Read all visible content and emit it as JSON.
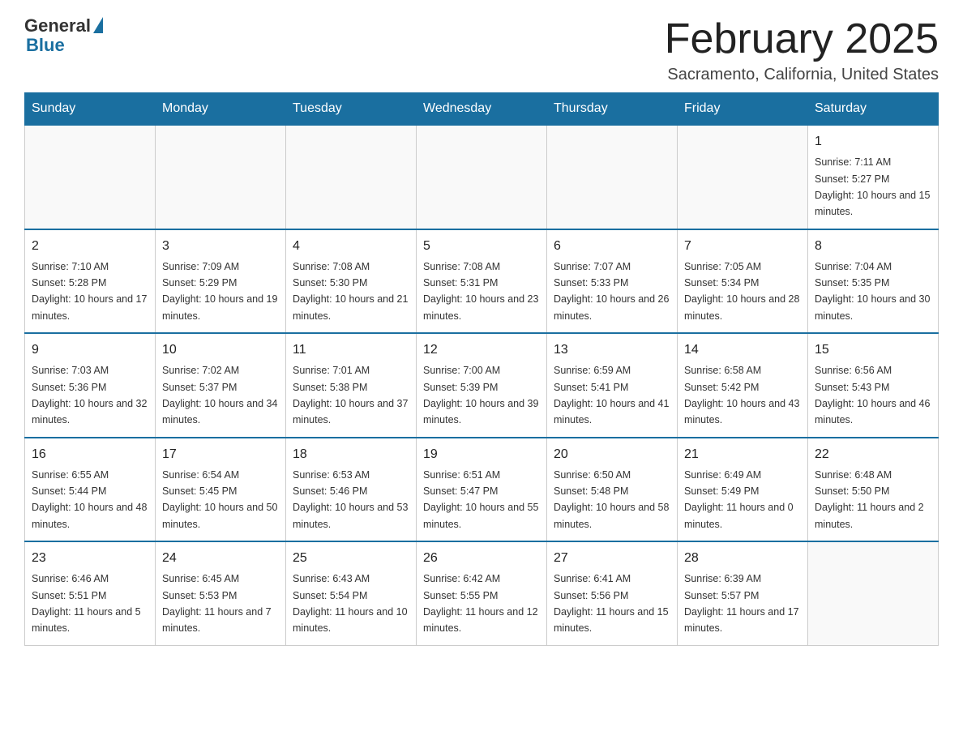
{
  "logo": {
    "general": "General",
    "blue": "Blue"
  },
  "title": "February 2025",
  "subtitle": "Sacramento, California, United States",
  "days_of_week": [
    "Sunday",
    "Monday",
    "Tuesday",
    "Wednesday",
    "Thursday",
    "Friday",
    "Saturday"
  ],
  "weeks": [
    [
      {
        "day": "",
        "info": ""
      },
      {
        "day": "",
        "info": ""
      },
      {
        "day": "",
        "info": ""
      },
      {
        "day": "",
        "info": ""
      },
      {
        "day": "",
        "info": ""
      },
      {
        "day": "",
        "info": ""
      },
      {
        "day": "1",
        "info": "Sunrise: 7:11 AM\nSunset: 5:27 PM\nDaylight: 10 hours and 15 minutes."
      }
    ],
    [
      {
        "day": "2",
        "info": "Sunrise: 7:10 AM\nSunset: 5:28 PM\nDaylight: 10 hours and 17 minutes."
      },
      {
        "day": "3",
        "info": "Sunrise: 7:09 AM\nSunset: 5:29 PM\nDaylight: 10 hours and 19 minutes."
      },
      {
        "day": "4",
        "info": "Sunrise: 7:08 AM\nSunset: 5:30 PM\nDaylight: 10 hours and 21 minutes."
      },
      {
        "day": "5",
        "info": "Sunrise: 7:08 AM\nSunset: 5:31 PM\nDaylight: 10 hours and 23 minutes."
      },
      {
        "day": "6",
        "info": "Sunrise: 7:07 AM\nSunset: 5:33 PM\nDaylight: 10 hours and 26 minutes."
      },
      {
        "day": "7",
        "info": "Sunrise: 7:05 AM\nSunset: 5:34 PM\nDaylight: 10 hours and 28 minutes."
      },
      {
        "day": "8",
        "info": "Sunrise: 7:04 AM\nSunset: 5:35 PM\nDaylight: 10 hours and 30 minutes."
      }
    ],
    [
      {
        "day": "9",
        "info": "Sunrise: 7:03 AM\nSunset: 5:36 PM\nDaylight: 10 hours and 32 minutes."
      },
      {
        "day": "10",
        "info": "Sunrise: 7:02 AM\nSunset: 5:37 PM\nDaylight: 10 hours and 34 minutes."
      },
      {
        "day": "11",
        "info": "Sunrise: 7:01 AM\nSunset: 5:38 PM\nDaylight: 10 hours and 37 minutes."
      },
      {
        "day": "12",
        "info": "Sunrise: 7:00 AM\nSunset: 5:39 PM\nDaylight: 10 hours and 39 minutes."
      },
      {
        "day": "13",
        "info": "Sunrise: 6:59 AM\nSunset: 5:41 PM\nDaylight: 10 hours and 41 minutes."
      },
      {
        "day": "14",
        "info": "Sunrise: 6:58 AM\nSunset: 5:42 PM\nDaylight: 10 hours and 43 minutes."
      },
      {
        "day": "15",
        "info": "Sunrise: 6:56 AM\nSunset: 5:43 PM\nDaylight: 10 hours and 46 minutes."
      }
    ],
    [
      {
        "day": "16",
        "info": "Sunrise: 6:55 AM\nSunset: 5:44 PM\nDaylight: 10 hours and 48 minutes."
      },
      {
        "day": "17",
        "info": "Sunrise: 6:54 AM\nSunset: 5:45 PM\nDaylight: 10 hours and 50 minutes."
      },
      {
        "day": "18",
        "info": "Sunrise: 6:53 AM\nSunset: 5:46 PM\nDaylight: 10 hours and 53 minutes."
      },
      {
        "day": "19",
        "info": "Sunrise: 6:51 AM\nSunset: 5:47 PM\nDaylight: 10 hours and 55 minutes."
      },
      {
        "day": "20",
        "info": "Sunrise: 6:50 AM\nSunset: 5:48 PM\nDaylight: 10 hours and 58 minutes."
      },
      {
        "day": "21",
        "info": "Sunrise: 6:49 AM\nSunset: 5:49 PM\nDaylight: 11 hours and 0 minutes."
      },
      {
        "day": "22",
        "info": "Sunrise: 6:48 AM\nSunset: 5:50 PM\nDaylight: 11 hours and 2 minutes."
      }
    ],
    [
      {
        "day": "23",
        "info": "Sunrise: 6:46 AM\nSunset: 5:51 PM\nDaylight: 11 hours and 5 minutes."
      },
      {
        "day": "24",
        "info": "Sunrise: 6:45 AM\nSunset: 5:53 PM\nDaylight: 11 hours and 7 minutes."
      },
      {
        "day": "25",
        "info": "Sunrise: 6:43 AM\nSunset: 5:54 PM\nDaylight: 11 hours and 10 minutes."
      },
      {
        "day": "26",
        "info": "Sunrise: 6:42 AM\nSunset: 5:55 PM\nDaylight: 11 hours and 12 minutes."
      },
      {
        "day": "27",
        "info": "Sunrise: 6:41 AM\nSunset: 5:56 PM\nDaylight: 11 hours and 15 minutes."
      },
      {
        "day": "28",
        "info": "Sunrise: 6:39 AM\nSunset: 5:57 PM\nDaylight: 11 hours and 17 minutes."
      },
      {
        "day": "",
        "info": ""
      }
    ]
  ]
}
